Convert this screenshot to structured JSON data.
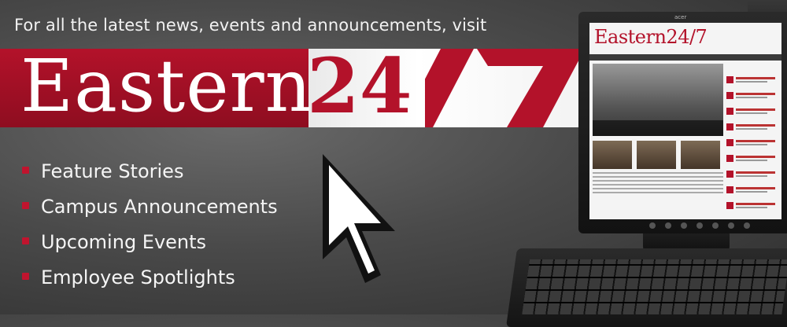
{
  "tagline": "For all the latest news, events and announcements, visit",
  "logo": {
    "word": "Eastern",
    "number": "24",
    "slash_number": "7",
    "colors": {
      "brand_red": "#b3122a",
      "band_light": "#f3f3f3",
      "text_white": "#ffffff"
    }
  },
  "features": [
    {
      "label": "Feature Stories"
    },
    {
      "label": "Campus Announcements"
    },
    {
      "label": "Upcoming Events"
    },
    {
      "label": "Employee Spotlights"
    }
  ],
  "cursor": {
    "icon": "arrow-cursor-icon"
  },
  "monitor": {
    "brand": "acer",
    "screen_logo": "Eastern24/7"
  }
}
